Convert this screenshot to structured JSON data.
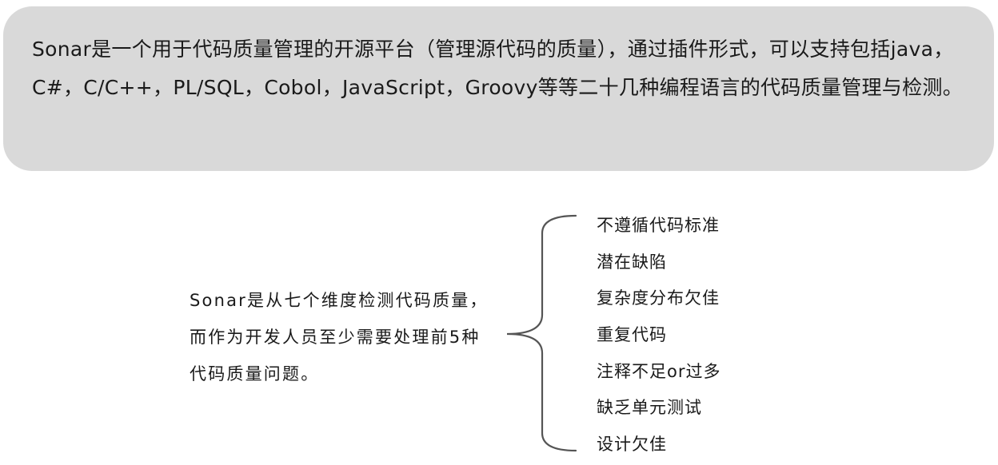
{
  "intro": {
    "text": "Sonar是一个用于代码质量管理的开源平台（管理源代码的质量），通过插件形式，可以支持包括java，C#，C/C++，PL/SQL，Cobol，JavaScript，Groovy等等二十几种编程语言的代码质量管理与检测。"
  },
  "description": {
    "text": "Sonar是从七个维度检测代码质量，而作为开发人员至少需要处理前5种代码质量问题。"
  },
  "dimensions": [
    "不遵循代码标准",
    "潜在缺陷",
    "复杂度分布欠佳",
    "重复代码",
    "注释不足or过多",
    "缺乏单元测试",
    "设计欠佳"
  ],
  "colors": {
    "box_background": "#d9d9d9",
    "brace_stroke": "#555555"
  }
}
